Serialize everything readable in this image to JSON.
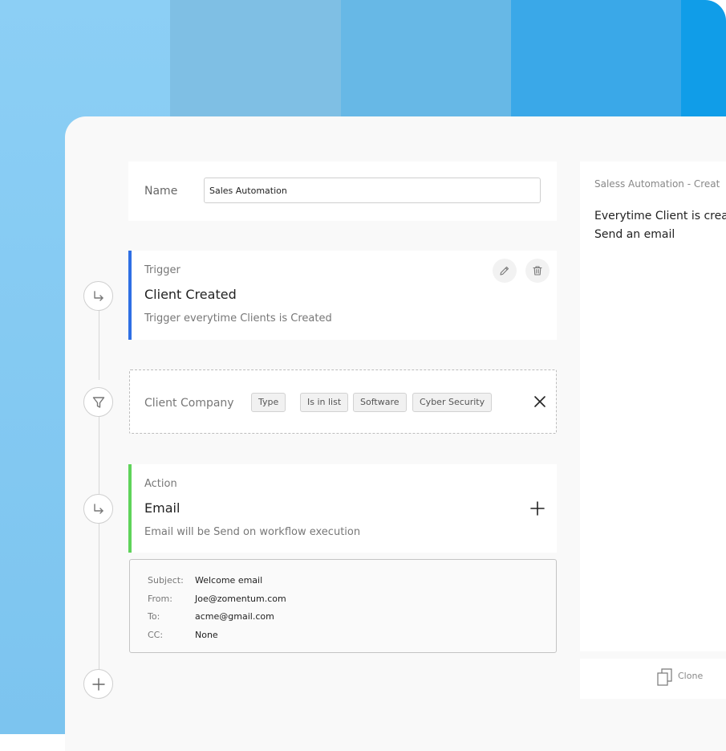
{
  "form": {
    "name_label": "Name",
    "name_value": "Sales Automation"
  },
  "trigger": {
    "section_label": "Trigger",
    "title": "Client Created",
    "description": "Trigger everytime Clients is Created",
    "icons": [
      "edit-icon",
      "trash-icon"
    ]
  },
  "filter": {
    "label": "Client Company",
    "chips": [
      "Type",
      "Is in list",
      "Software",
      "Cyber Security"
    ],
    "close_icon": "close-icon"
  },
  "action": {
    "section_label": "Action",
    "title": "Email",
    "description": "Email will be Send on workflow execution",
    "add_icon": "plus-icon"
  },
  "email": {
    "subject_label": "Subject:",
    "subject_value": "Welcome email",
    "from_label": "From:",
    "from_value": "Joe@zomentum.com",
    "to_label": "To:",
    "to_value": "acme@gmail.com",
    "cc_label": "CC:",
    "cc_value": "None"
  },
  "preview": {
    "title": "Saless Automation - Creat",
    "line1": "Everytime Client is crea",
    "line2": "Send an email"
  },
  "footer": {
    "clone_label": "Clone"
  },
  "colors": {
    "trigger_accent": "#2f6fe4",
    "action_accent": "#5fd35a"
  }
}
